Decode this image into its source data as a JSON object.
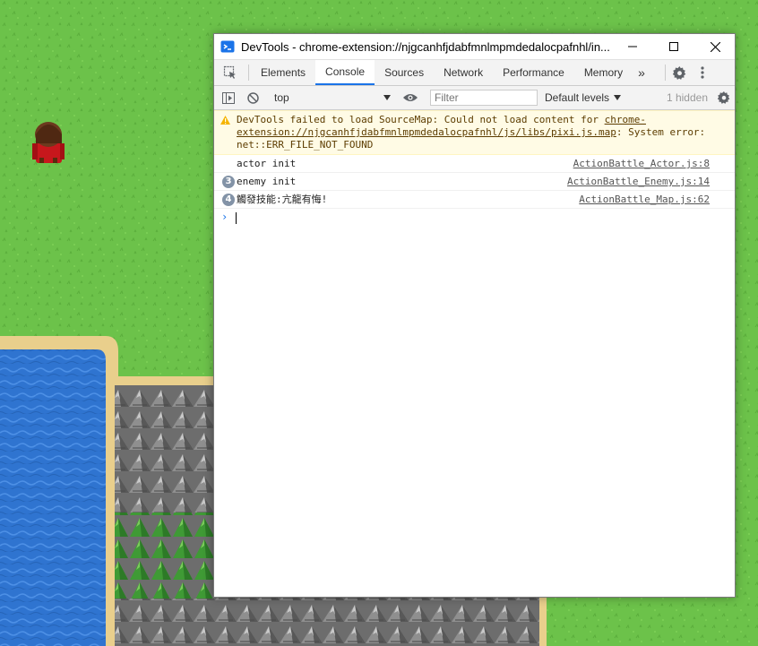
{
  "devtools": {
    "window_title": "DevTools - chrome-extension://njgcanhfjdabfmnlmpmdedalocpafnhl/in...",
    "tabs": [
      {
        "label": "Elements",
        "active": false
      },
      {
        "label": "Console",
        "active": true
      },
      {
        "label": "Sources",
        "active": false
      },
      {
        "label": "Network",
        "active": false
      },
      {
        "label": "Performance",
        "active": false
      },
      {
        "label": "Memory",
        "active": false
      }
    ],
    "more_tabs": "»",
    "toolbar": {
      "context": "top",
      "filter_placeholder": "Filter",
      "levels": "Default levels",
      "hidden_count": "1 hidden"
    },
    "messages": {
      "warning": {
        "text_start": "DevTools failed to load SourceMap: Could not load content for ",
        "url": "chrome-extension://njgcanhfjdabfmnlmpmdedalocpafnhl/js/libs/pixi.js.map",
        "text_end": ": System error: net::ERR_FILE_NOT_FOUND"
      },
      "logs": [
        {
          "count": "",
          "text": "actor init",
          "source": "ActionBattle_Actor.js:8"
        },
        {
          "count": "3",
          "text": "enemy init",
          "source": "ActionBattle_Enemy.js:14"
        },
        {
          "count": "4",
          "text": "觸發技能:亢龍有悔!",
          "source": "ActionBattle_Map.js:62"
        }
      ]
    },
    "prompt_symbol": "›"
  },
  "colors": {
    "grass": "#6cc24a",
    "water": "#2f74d0",
    "sand": "#e9cf8c",
    "accent": "#1a73e8",
    "warning_bg": "#fffbe5"
  }
}
